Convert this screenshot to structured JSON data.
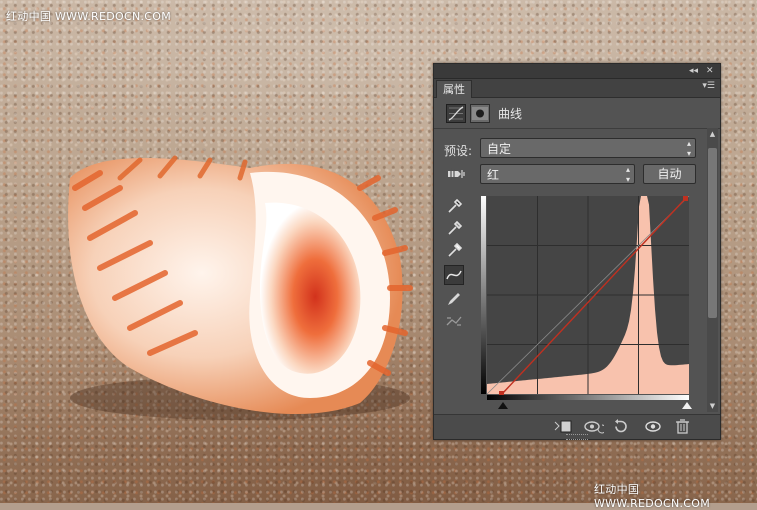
{
  "watermark": {
    "top": "红动中国 WWW.REDOCN.COM",
    "bottom": "红动中国 WWW.REDOCN.COM"
  },
  "panel": {
    "tab_label": "属性",
    "title": "曲线",
    "preset_label": "预设:",
    "preset_value": "自定",
    "channel_value": "红",
    "auto_button": "自动",
    "icons": {
      "collapse": "double-chevron-left-icon",
      "close": "close-icon",
      "menu": "panel-menu-icon",
      "adjustment": "curves-adjustment-icon",
      "mask": "layer-mask-icon"
    },
    "tools": [
      "on-image-adjust-icon",
      "black-point-eyedropper-icon",
      "gray-point-eyedropper-icon",
      "white-point-eyedropper-icon",
      "curve-point-tool-icon",
      "pencil-draw-icon",
      "smooth-curve-icon"
    ],
    "footer_icons": [
      "clip-to-layer-icon",
      "view-previous-state-icon",
      "reset-adjustment-icon",
      "visibility-eye-icon",
      "trash-icon"
    ]
  },
  "colors": {
    "histogram": "#f8c2ad",
    "curve": "#c03020",
    "panel_bg": "#535353",
    "graph_bg": "#454545"
  }
}
